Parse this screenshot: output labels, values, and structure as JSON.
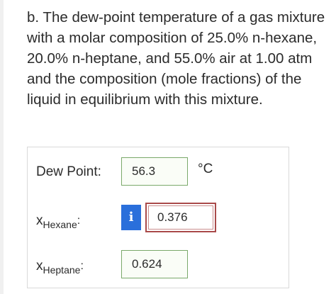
{
  "question": {
    "text": "b. The dew-point temperature of a gas mixture with a molar composition of 25.0% n-hexane, 20.0% n-heptane, and 55.0% air at 1.00 atm and the composition (mole fractions) of the liquid in equilibrium with this mixture."
  },
  "answers": {
    "dew_point": {
      "label": "Dew Point:",
      "value": "56.3",
      "unit": "°C"
    },
    "x_hexane": {
      "symbol": "x",
      "subscript": "Hexane",
      "colon": ":",
      "value": "0.376",
      "info_icon_glyph": "i"
    },
    "x_heptane": {
      "symbol": "x",
      "subscript": "Heptane",
      "colon": ":",
      "value": "0.624"
    }
  },
  "colors": {
    "correct_border": "#7aa96a",
    "incorrect_border": "#a94a4a",
    "info_badge": "#2a6fdb"
  }
}
